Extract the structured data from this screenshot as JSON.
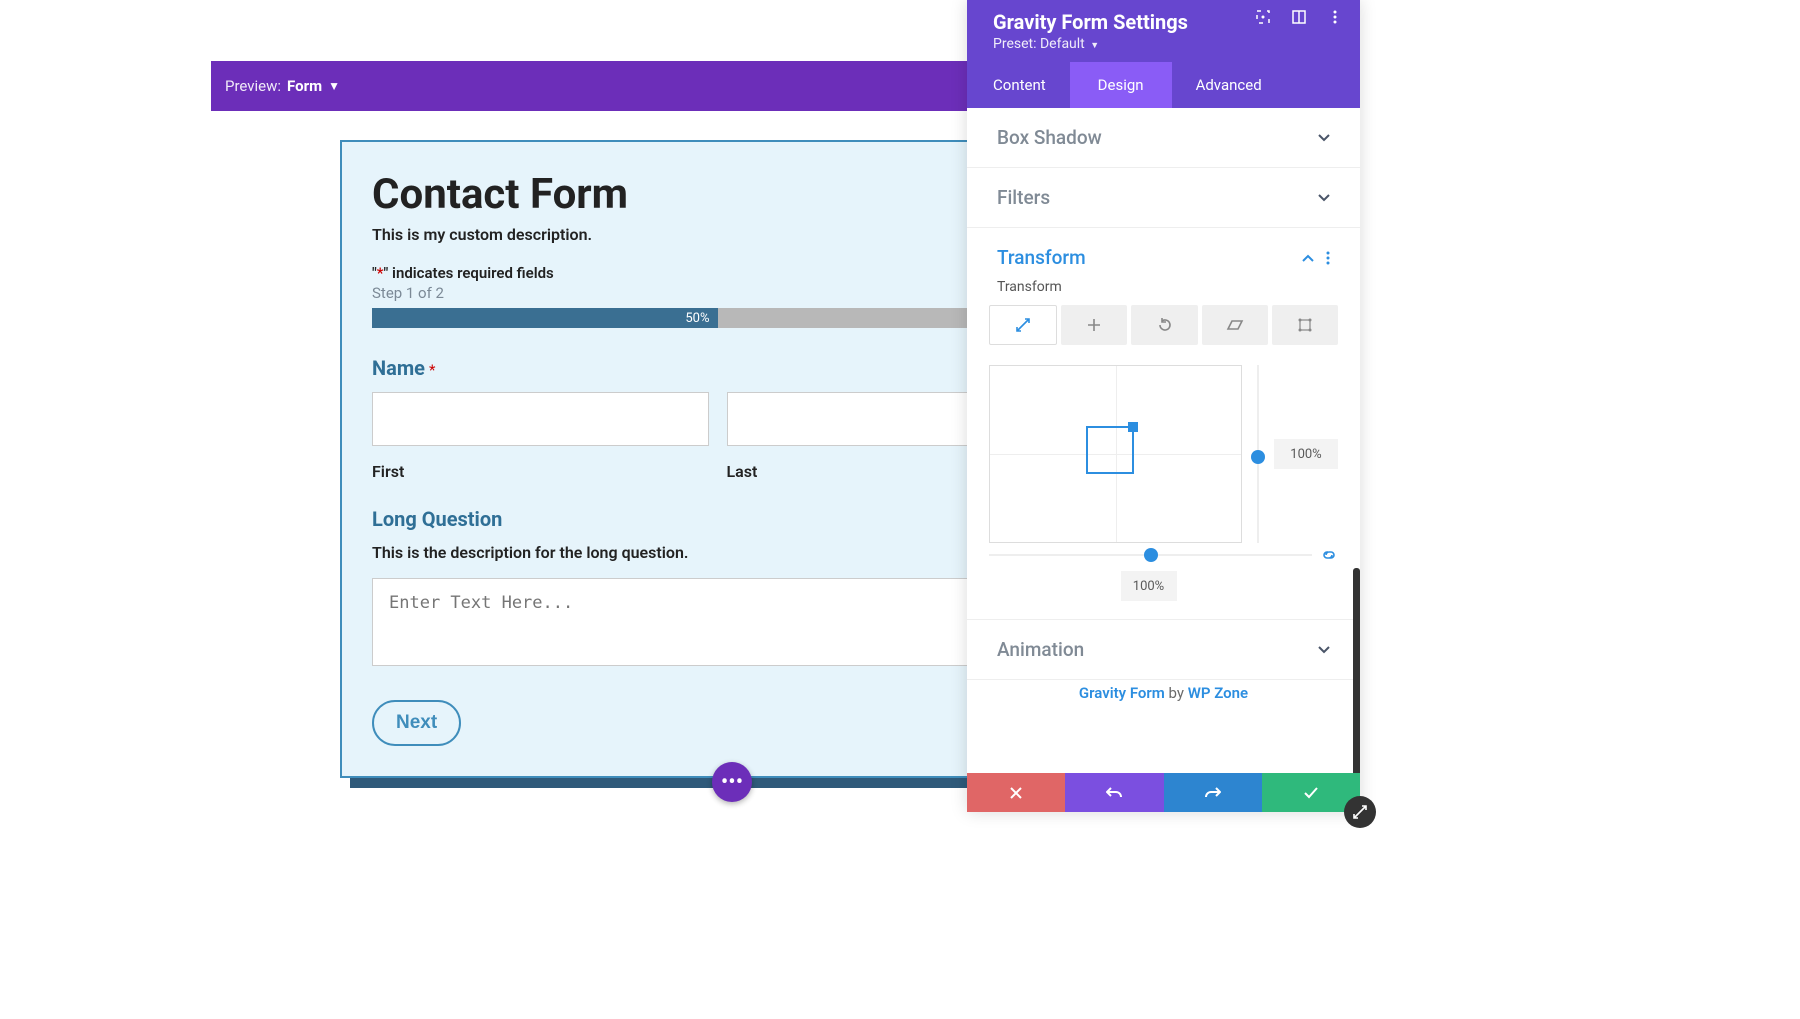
{
  "preview_bar": {
    "label": "Preview:",
    "value": "Form"
  },
  "form": {
    "title": "Contact Form",
    "description": "This is my custom description.",
    "required_prefix": "\"",
    "required_star": "*",
    "required_suffix": "\" indicates required fields",
    "step_text": "Step 1 of 2",
    "progress_pct_text": "50%",
    "name_label": "Name",
    "first_label": "First",
    "last_label": "Last",
    "long_q_label": "Long Question",
    "long_q_desc": "This is the description for the long question.",
    "textarea_placeholder": "Enter Text Here...",
    "next_label": "Next"
  },
  "panel": {
    "title": "Gravity Form Settings",
    "preset_label": "Preset: Default",
    "tabs": {
      "content": "Content",
      "design": "Design",
      "advanced": "Advanced"
    },
    "sections": {
      "box_shadow": "Box Shadow",
      "filters": "Filters",
      "transform": "Transform",
      "animation": "Animation"
    },
    "transform_field_label": "Transform",
    "slider_v_value": "100%",
    "slider_h_value": "100%",
    "credit": {
      "a1": "Gravity Form",
      "by": " by ",
      "a2": "WP Zone"
    }
  }
}
